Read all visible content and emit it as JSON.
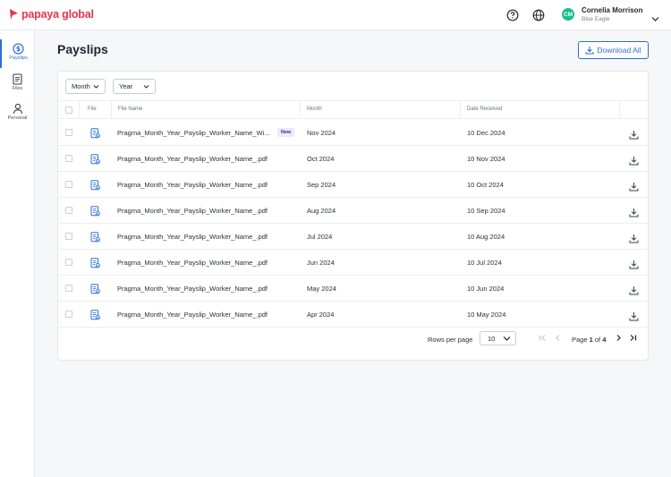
{
  "brand": {
    "name": "papaya global",
    "color": "#e8344a"
  },
  "user": {
    "initials": "CM",
    "name": "Cornelia Morrison",
    "team": "Blue Eagle"
  },
  "sidebar": {
    "items": [
      {
        "label": "Payslips",
        "icon": "dollar-circle-icon",
        "active": true
      },
      {
        "label": "Files",
        "icon": "file-icon",
        "active": false
      },
      {
        "label": "Personal",
        "icon": "person-icon",
        "active": false
      }
    ]
  },
  "page": {
    "title": "Payslips",
    "download_all_label": "Download All"
  },
  "filters": {
    "month_label": "Month",
    "year_label": "Year"
  },
  "table": {
    "columns": {
      "file": "File",
      "file_name": "File Name",
      "month": "Month",
      "date_received": "Date Received"
    },
    "rows": [
      {
        "file_name": "Pragma_Month_Year_Payslip_Worker_Name_Wi...",
        "badge": "New",
        "month": "Nov 2024",
        "date_received": "10 Dec 2024"
      },
      {
        "file_name": "Pragma_Month_Year_Payslip_Worker_Name_.pdf",
        "month": "Oct 2024",
        "date_received": "10 Nov 2024"
      },
      {
        "file_name": "Pragma_Month_Year_Payslip_Worker_Name_.pdf",
        "month": "Sep 2024",
        "date_received": "10 Oct 2024"
      },
      {
        "file_name": "Pragma_Month_Year_Payslip_Worker_Name_.pdf",
        "month": "Aug 2024",
        "date_received": "10 Sep 2024"
      },
      {
        "file_name": "Pragma_Month_Year_Payslip_Worker_Name_.pdf",
        "month": "Jul 2024",
        "date_received": "10 Aug 2024"
      },
      {
        "file_name": "Pragma_Month_Year_Payslip_Worker_Name_.pdf",
        "month": "Jun 2024",
        "date_received": "10 Jul 2024"
      },
      {
        "file_name": "Pragma_Month_Year_Payslip_Worker_Name_.pdf",
        "month": "May 2024",
        "date_received": "10 Jun 2024"
      },
      {
        "file_name": "Pragma_Month_Year_Payslip_Worker_Name_.pdf",
        "month": "Apr 2024",
        "date_received": "10 May 2024"
      }
    ]
  },
  "pagination": {
    "rows_per_page_label": "Rows per page",
    "rows_per_page": "10",
    "page_prefix": "Page",
    "current_page": "1",
    "page_of": "of",
    "total_pages": "4"
  },
  "colors": {
    "accent": "#2b6fd6",
    "badge_bg": "#ece8fb",
    "avatar": "#1bbf8e"
  }
}
